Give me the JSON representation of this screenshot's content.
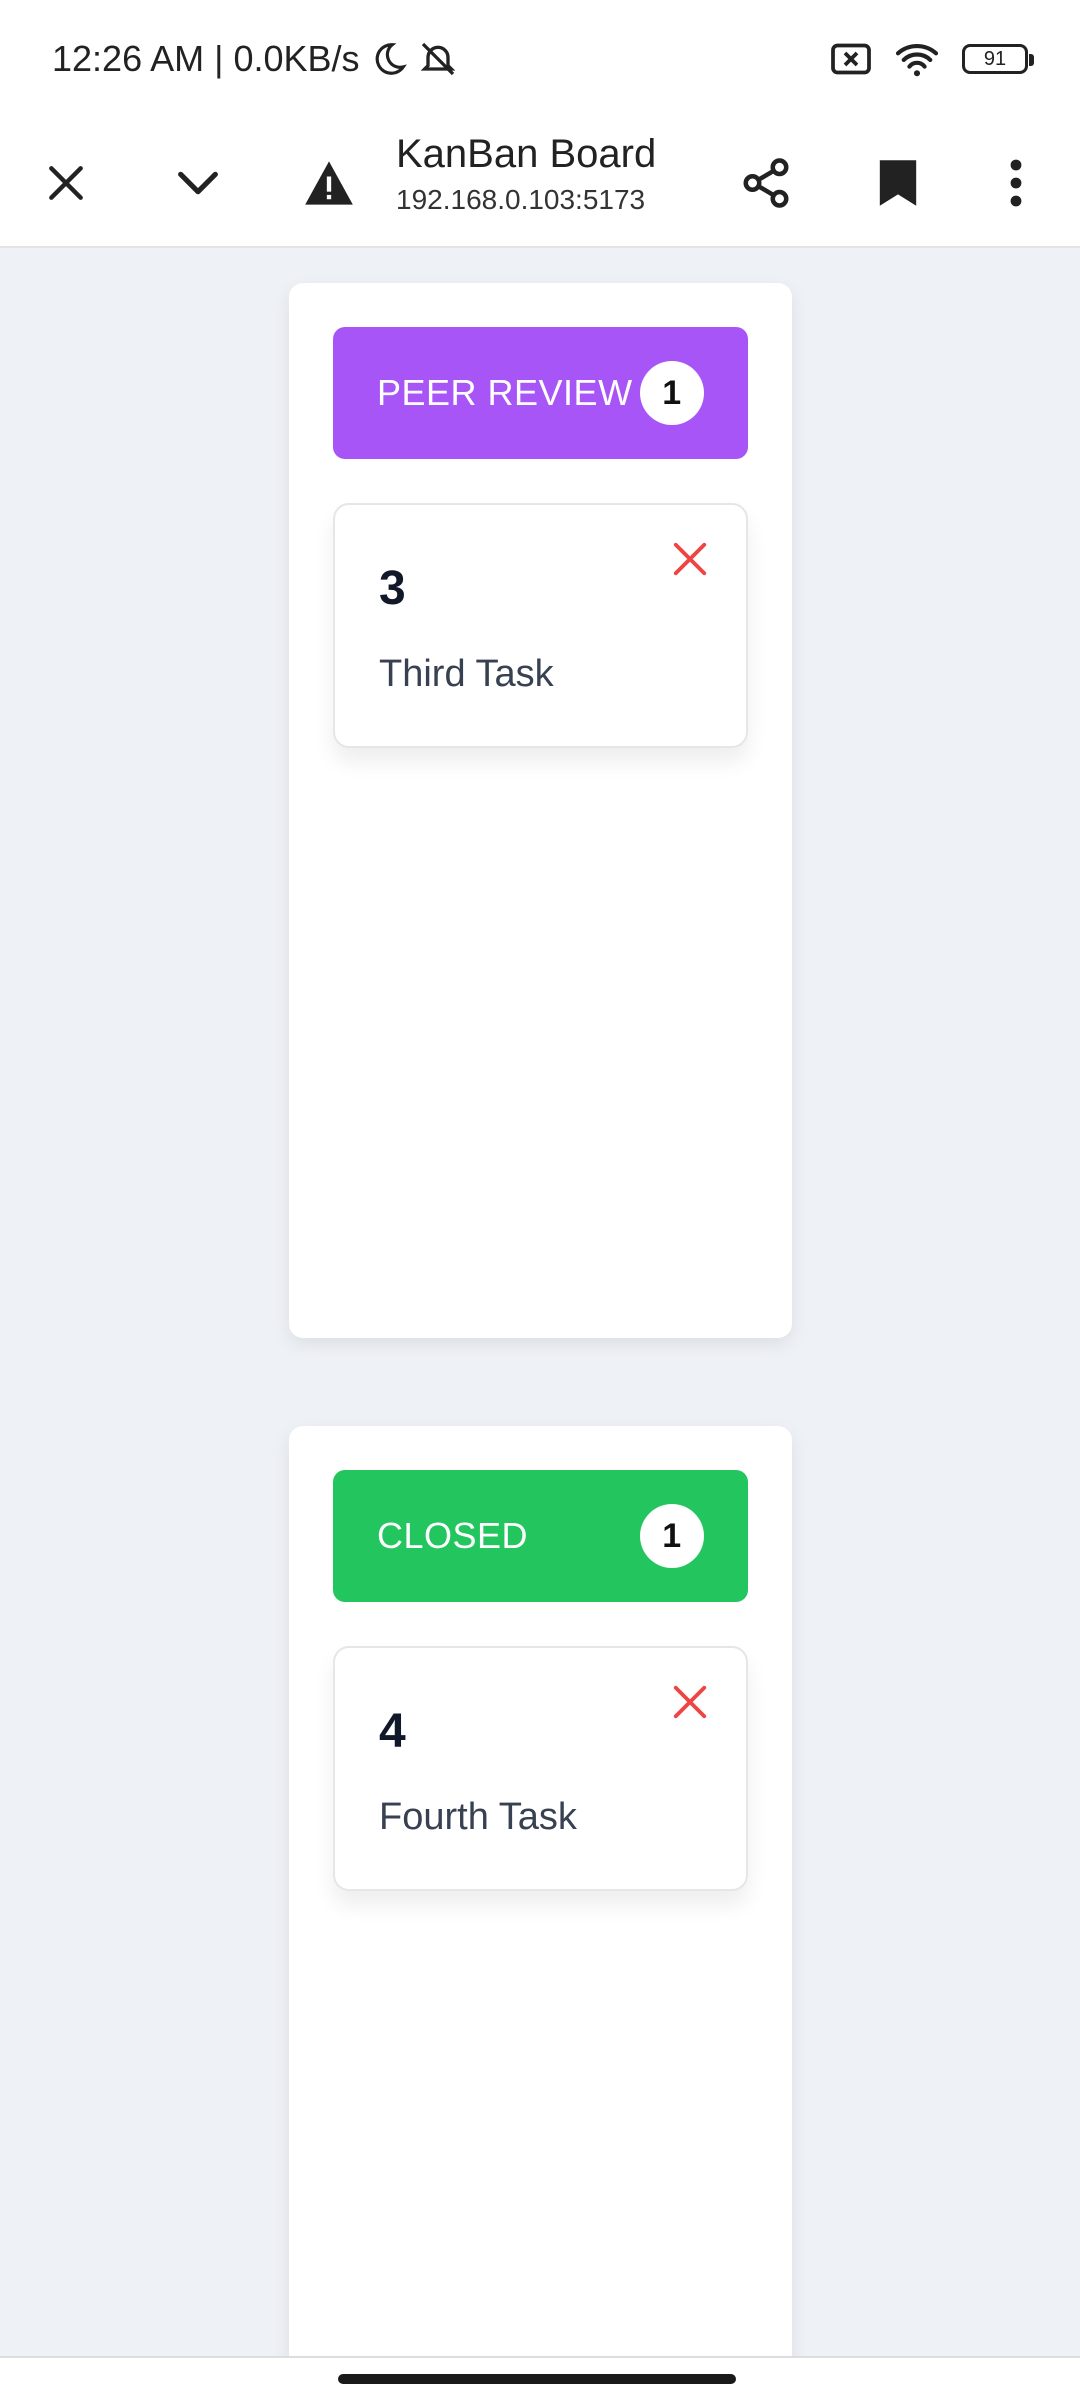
{
  "status_bar": {
    "time": "12:26 AM",
    "separator": "|",
    "speed": "0.0KB/s",
    "battery": "91"
  },
  "browser": {
    "title": "KanBan Board",
    "url": "192.168.0.103:5173"
  },
  "columns": [
    {
      "title": "PEER REVIEW",
      "count": "1",
      "color": "#a855f7",
      "tasks": [
        {
          "id": "3",
          "name": "Third Task"
        }
      ]
    },
    {
      "title": "CLOSED",
      "count": "1",
      "color": "#22c55e",
      "tasks": [
        {
          "id": "4",
          "name": "Fourth Task"
        }
      ]
    }
  ],
  "colors": {
    "delete": "#ef4444",
    "background": "#eef1f6"
  }
}
